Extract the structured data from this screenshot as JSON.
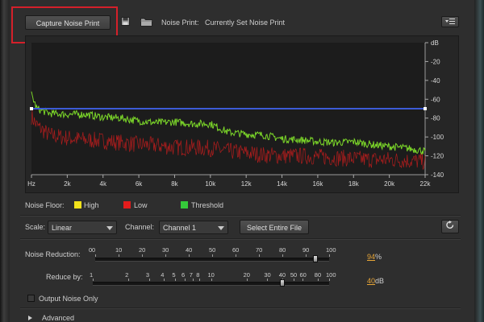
{
  "toolbar": {
    "capture_label": "Capture Noise Print",
    "save_icon": "save-icon",
    "open_icon": "folder-icon",
    "noise_print_label": "Noise Print:",
    "noise_print_value": "Currently Set Noise Print",
    "menu_icon": "panel-menu-icon"
  },
  "legend": {
    "title": "Noise Floor:",
    "items": [
      {
        "label": "High",
        "color": "#f2e21b"
      },
      {
        "label": "Low",
        "color": "#e31c1c"
      },
      {
        "label": "Threshold",
        "color": "#35c93a"
      }
    ]
  },
  "chart_data": {
    "type": "line",
    "x_ticks": [
      "Hz",
      "2k",
      "4k",
      "6k",
      "8k",
      "10k",
      "12k",
      "14k",
      "16k",
      "18k",
      "20k",
      "22k"
    ],
    "y_ticks": [
      "dB",
      "-20",
      "-40",
      "-60",
      "-80",
      "-100",
      "-120",
      "-140"
    ],
    "xlim": [
      0,
      22000
    ],
    "ylim": [
      -140,
      0
    ],
    "series": [
      {
        "name": "Threshold",
        "color": "#7bd629",
        "x": [
          0,
          300,
          1000,
          2000,
          3000,
          4000,
          5000,
          6000,
          7000,
          8000,
          9000,
          10000,
          11000,
          12000,
          13000,
          14000,
          15000,
          16000,
          17000,
          18000,
          19000,
          20000,
          21000,
          22000
        ],
        "y": [
          -55,
          -70,
          -75,
          -76,
          -76,
          -79,
          -80,
          -83,
          -85,
          -84,
          -86,
          -86,
          -95,
          -97,
          -98,
          -102,
          -103,
          -105,
          -106,
          -105,
          -108,
          -110,
          -112,
          -115
        ]
      },
      {
        "name": "Low",
        "color": "#c81d1d",
        "x": [
          0,
          300,
          1000,
          2000,
          3000,
          4000,
          5000,
          6000,
          7000,
          8000,
          9000,
          10000,
          11000,
          12000,
          13000,
          14000,
          15000,
          16000,
          17000,
          18000,
          19000,
          20000,
          21000,
          22000
        ],
        "y": [
          -78,
          -88,
          -98,
          -101,
          -103,
          -104,
          -106,
          -108,
          -109,
          -111,
          -111,
          -112,
          -115,
          -117,
          -119,
          -120,
          -120,
          -121,
          -122,
          -123,
          -124,
          -124,
          -125,
          -126
        ]
      },
      {
        "name": "Noise Reduction",
        "color": "#3c5bd6",
        "x": [
          0,
          22000
        ],
        "y": [
          -70,
          -70
        ]
      }
    ],
    "grid": false
  },
  "controls": {
    "scale_label": "Scale:",
    "scale_value": "Linear",
    "channel_label": "Channel:",
    "channel_value": "Channel 1",
    "select_file_label": "Select Entire File",
    "reset_icon": "reset-icon",
    "noise_reduction_label": "Noise Reduction:",
    "noise_reduction_scale": [
      "0",
      "0",
      "10",
      "20",
      "30",
      "40",
      "50",
      "60",
      "70",
      "80",
      "90",
      "100"
    ],
    "noise_reduction_value": "94",
    "noise_reduction_unit": "%",
    "noise_reduction_level": 0.94,
    "reduce_by_label": "Reduce by:",
    "reduce_by_scale": [
      "1",
      "2",
      "3",
      "4",
      "5",
      "6",
      "7",
      "8",
      "10",
      "20",
      "30",
      "40",
      "50",
      "60",
      "80",
      "100"
    ],
    "reduce_by_value": "40",
    "reduce_by_unit": "dB",
    "reduce_by_level": 40,
    "output_noise_label": "Output Noise Only",
    "advanced_label": "Advanced"
  }
}
